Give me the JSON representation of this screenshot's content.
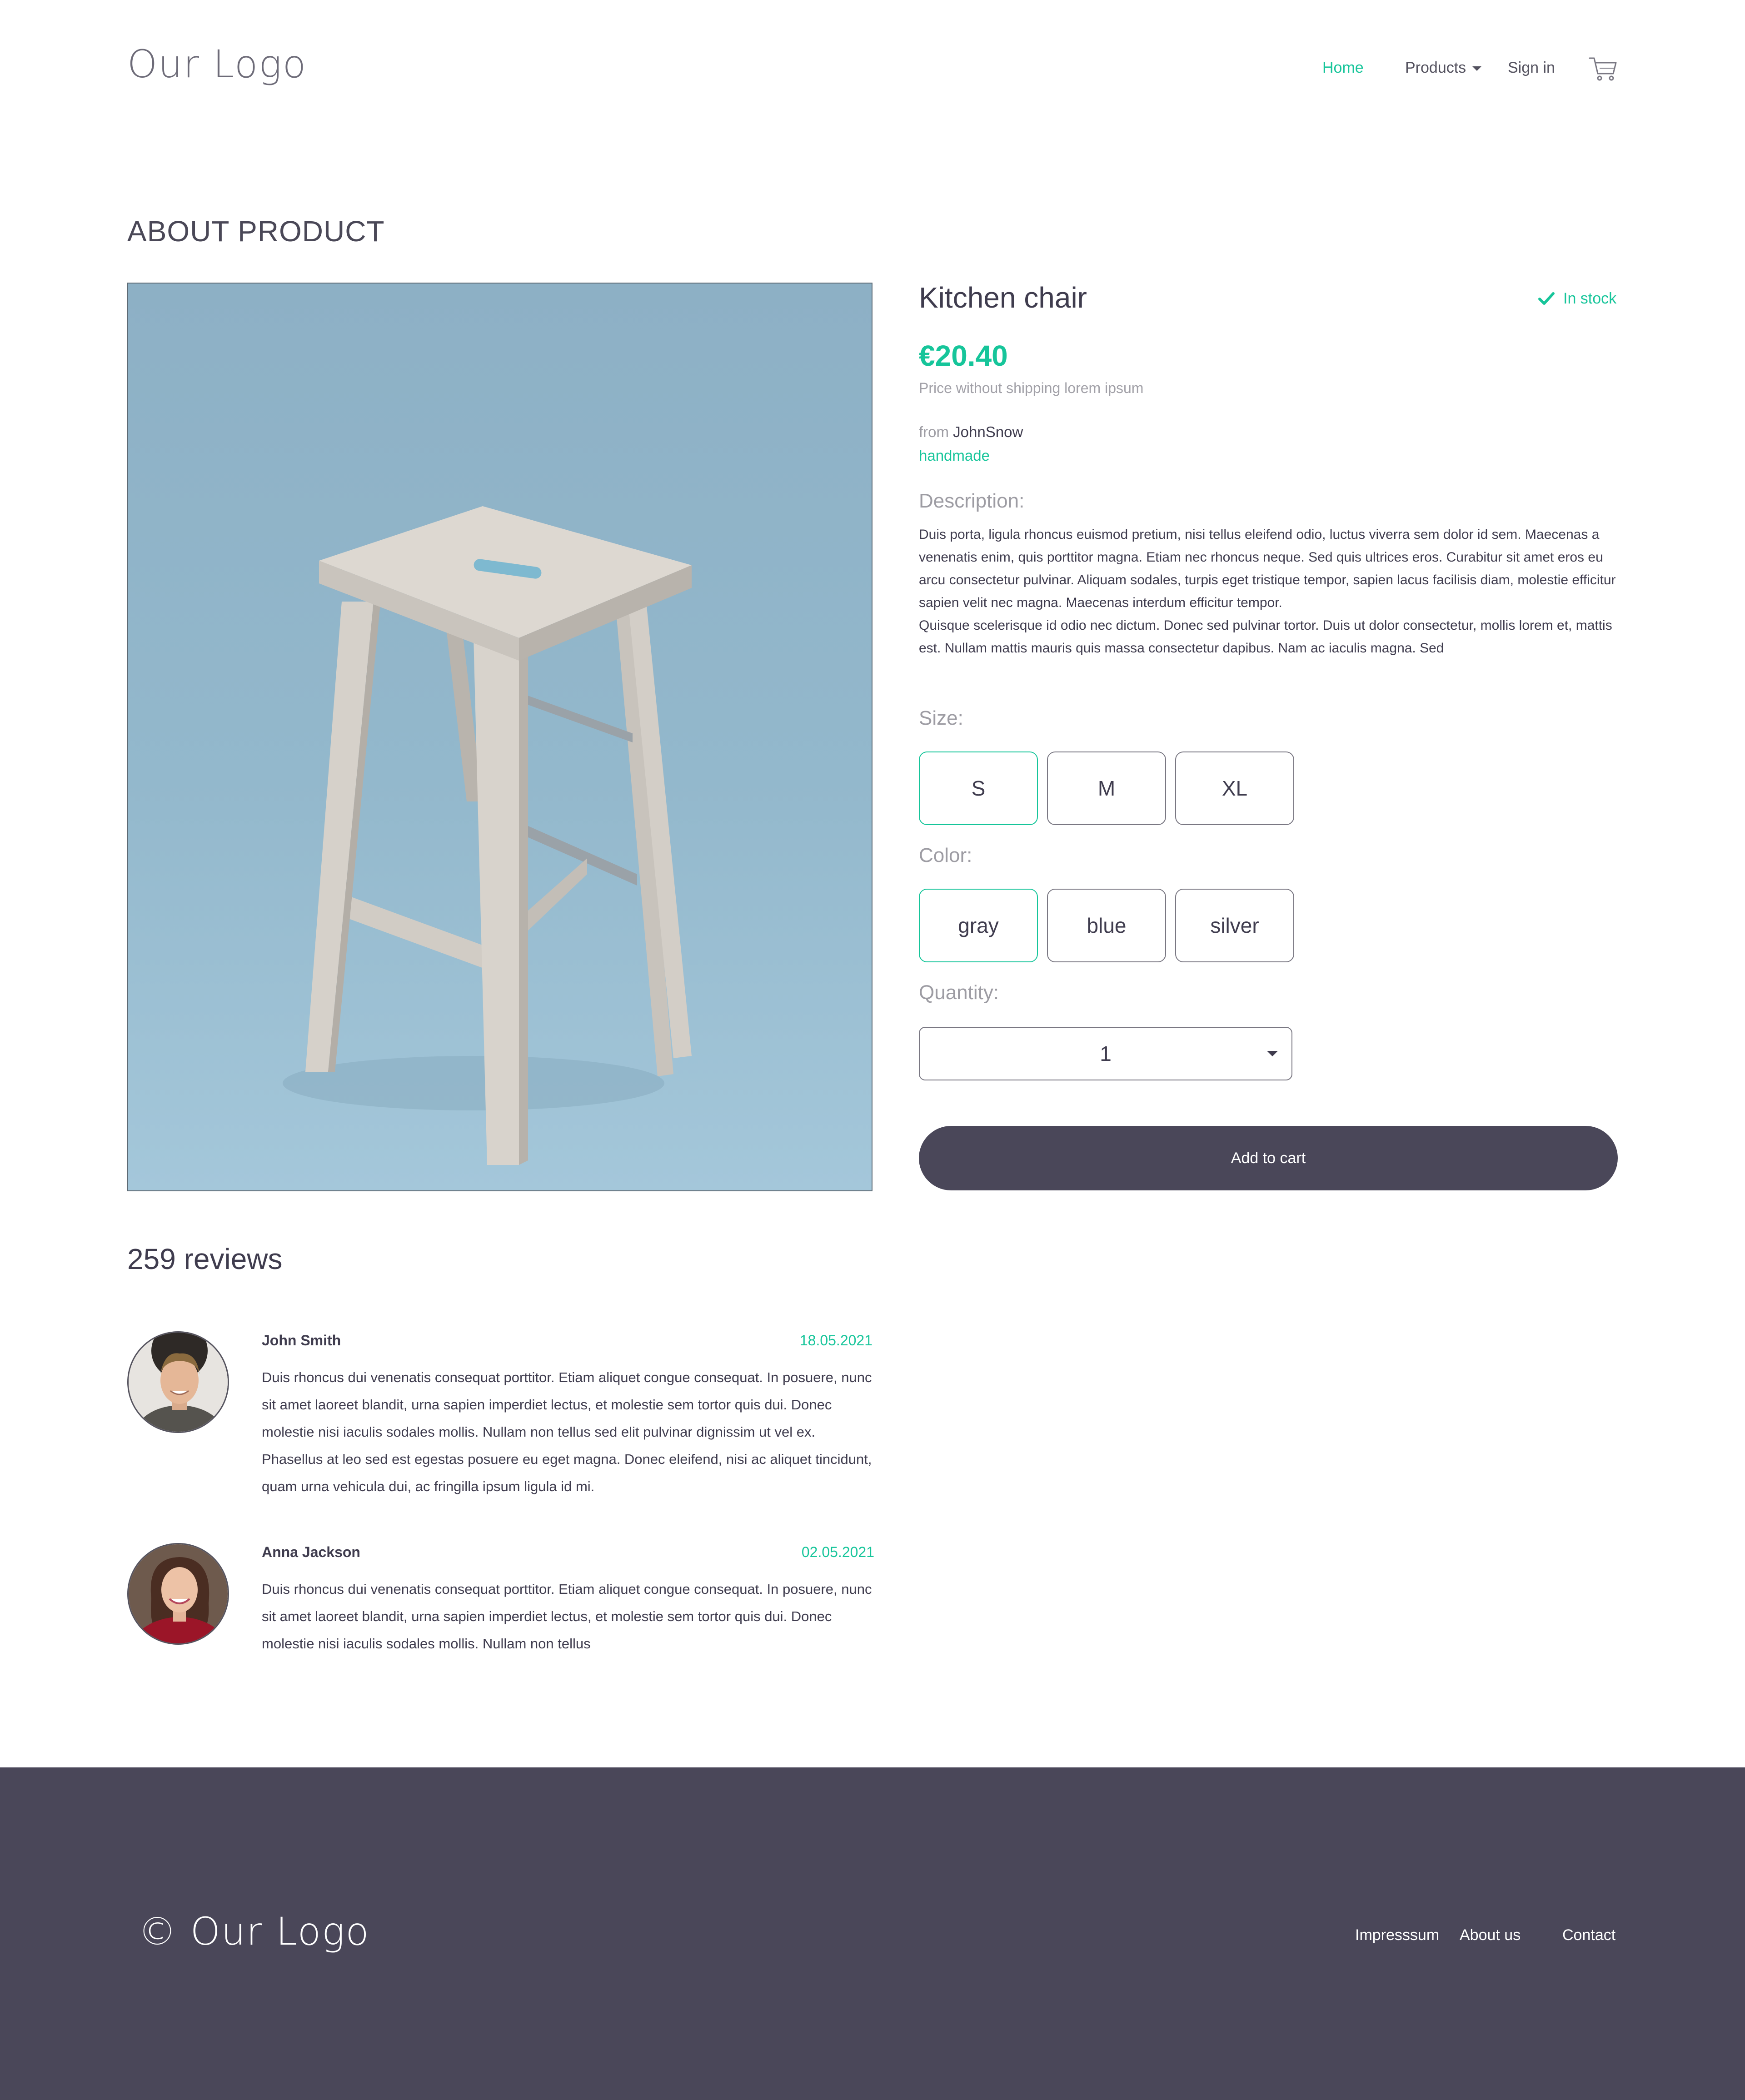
{
  "header": {
    "logo": "Our Logo",
    "nav": {
      "home": "Home",
      "products": "Products",
      "signin": "Sign in"
    },
    "cart_icon": "shopping-cart-icon",
    "accent_color": "#16c59a"
  },
  "page": {
    "section_title": "ABOUT PRODUCT"
  },
  "product": {
    "name": "Kitchen chair",
    "stock": "In stock",
    "price": "€20.40",
    "price_note": "Price without shipping lorem ipsum",
    "from_label": "from",
    "seller": "JohnSnow",
    "tag": "handmade",
    "description_label": "Description:",
    "description": "Duis porta, ligula rhoncus euismod pretium, nisi tellus eleifend odio, luctus viverra sem dolor id sem. Maecenas a venenatis enim, quis porttitor magna. Etiam nec rhoncus neque. Sed quis ultrices eros. Curabitur sit amet eros eu arcu consectetur pulvinar. Aliquam sodales, turpis eget tristique tempor, sapien lacus facilisis diam, molestie efficitur sapien velit nec magna. Maecenas interdum efficitur tempor.\nQuisque scelerisque id odio nec dictum. Donec sed pulvinar tortor. Duis ut dolor consectetur, mollis lorem et, mattis est. Nullam mattis mauris quis massa consectetur dapibus. Nam ac iaculis magna. Sed",
    "size_label": "Size:",
    "sizes": [
      "S",
      "M",
      "XL"
    ],
    "selected_size": "S",
    "color_label": "Color:",
    "colors": [
      "gray",
      "blue",
      "silver"
    ],
    "selected_color": "gray",
    "quantity_label": "Quantity:",
    "quantity": "1",
    "add_to_cart": "Add to cart",
    "image_background_color": "#93b8cc"
  },
  "reviews": {
    "title": "259 reviews",
    "items": [
      {
        "name": "John Smith",
        "date": "18.05.2021",
        "text": "Duis rhoncus dui venenatis consequat porttitor. Etiam aliquet congue consequat. In posuere, nunc sit amet laoreet blandit, urna sapien imperdiet lectus, et molestie sem tortor quis dui. Donec molestie nisi iaculis sodales mollis. Nullam non tellus sed elit pulvinar dignissim ut vel ex. Phasellus at leo sed est egestas posuere eu eget magna. Donec eleifend, nisi ac aliquet tincidunt, quam urna vehicula dui, ac fringilla ipsum ligula id mi."
      },
      {
        "name": "Anna Jackson",
        "date": "02.05.2021",
        "text": "Duis rhoncus dui venenatis consequat porttitor. Etiam aliquet congue consequat. In posuere, nunc sit amet laoreet blandit, urna sapien imperdiet lectus, et molestie sem tortor quis dui. Donec molestie nisi iaculis sodales mollis. Nullam non tellus"
      }
    ]
  },
  "footer": {
    "logo": "© Our Logo",
    "links": {
      "impressum": "Impresssum",
      "about": "About us",
      "contact": "Contact"
    },
    "background_color": "#4a4759"
  }
}
